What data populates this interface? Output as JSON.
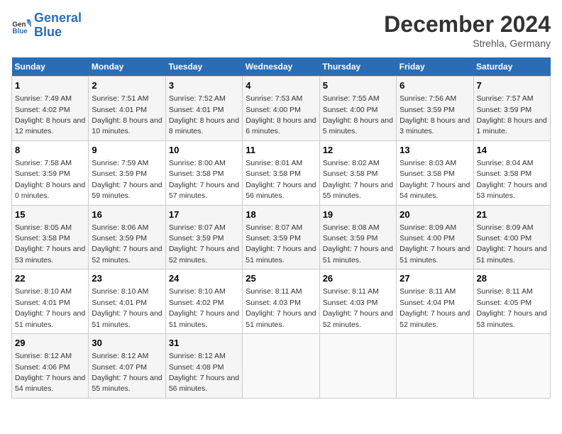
{
  "logo": {
    "line1": "General",
    "line2": "Blue"
  },
  "title": "December 2024",
  "location": "Strehla, Germany",
  "days_of_week": [
    "Sunday",
    "Monday",
    "Tuesday",
    "Wednesday",
    "Thursday",
    "Friday",
    "Saturday"
  ],
  "weeks": [
    [
      {
        "num": "1",
        "sunrise": "7:49 AM",
        "sunset": "4:02 PM",
        "daylight": "8 hours and 12 minutes."
      },
      {
        "num": "2",
        "sunrise": "7:51 AM",
        "sunset": "4:01 PM",
        "daylight": "8 hours and 10 minutes."
      },
      {
        "num": "3",
        "sunrise": "7:52 AM",
        "sunset": "4:01 PM",
        "daylight": "8 hours and 8 minutes."
      },
      {
        "num": "4",
        "sunrise": "7:53 AM",
        "sunset": "4:00 PM",
        "daylight": "8 hours and 6 minutes."
      },
      {
        "num": "5",
        "sunrise": "7:55 AM",
        "sunset": "4:00 PM",
        "daylight": "8 hours and 5 minutes."
      },
      {
        "num": "6",
        "sunrise": "7:56 AM",
        "sunset": "3:59 PM",
        "daylight": "8 hours and 3 minutes."
      },
      {
        "num": "7",
        "sunrise": "7:57 AM",
        "sunset": "3:59 PM",
        "daylight": "8 hours and 1 minute."
      }
    ],
    [
      {
        "num": "8",
        "sunrise": "7:58 AM",
        "sunset": "3:59 PM",
        "daylight": "8 hours and 0 minutes."
      },
      {
        "num": "9",
        "sunrise": "7:59 AM",
        "sunset": "3:59 PM",
        "daylight": "7 hours and 59 minutes."
      },
      {
        "num": "10",
        "sunrise": "8:00 AM",
        "sunset": "3:58 PM",
        "daylight": "7 hours and 57 minutes."
      },
      {
        "num": "11",
        "sunrise": "8:01 AM",
        "sunset": "3:58 PM",
        "daylight": "7 hours and 56 minutes."
      },
      {
        "num": "12",
        "sunrise": "8:02 AM",
        "sunset": "3:58 PM",
        "daylight": "7 hours and 55 minutes."
      },
      {
        "num": "13",
        "sunrise": "8:03 AM",
        "sunset": "3:58 PM",
        "daylight": "7 hours and 54 minutes."
      },
      {
        "num": "14",
        "sunrise": "8:04 AM",
        "sunset": "3:58 PM",
        "daylight": "7 hours and 53 minutes."
      }
    ],
    [
      {
        "num": "15",
        "sunrise": "8:05 AM",
        "sunset": "3:58 PM",
        "daylight": "7 hours and 53 minutes."
      },
      {
        "num": "16",
        "sunrise": "8:06 AM",
        "sunset": "3:59 PM",
        "daylight": "7 hours and 52 minutes."
      },
      {
        "num": "17",
        "sunrise": "8:07 AM",
        "sunset": "3:59 PM",
        "daylight": "7 hours and 52 minutes."
      },
      {
        "num": "18",
        "sunrise": "8:07 AM",
        "sunset": "3:59 PM",
        "daylight": "7 hours and 51 minutes."
      },
      {
        "num": "19",
        "sunrise": "8:08 AM",
        "sunset": "3:59 PM",
        "daylight": "7 hours and 51 minutes."
      },
      {
        "num": "20",
        "sunrise": "8:09 AM",
        "sunset": "4:00 PM",
        "daylight": "7 hours and 51 minutes."
      },
      {
        "num": "21",
        "sunrise": "8:09 AM",
        "sunset": "4:00 PM",
        "daylight": "7 hours and 51 minutes."
      }
    ],
    [
      {
        "num": "22",
        "sunrise": "8:10 AM",
        "sunset": "4:01 PM",
        "daylight": "7 hours and 51 minutes."
      },
      {
        "num": "23",
        "sunrise": "8:10 AM",
        "sunset": "4:01 PM",
        "daylight": "7 hours and 51 minutes."
      },
      {
        "num": "24",
        "sunrise": "8:10 AM",
        "sunset": "4:02 PM",
        "daylight": "7 hours and 51 minutes."
      },
      {
        "num": "25",
        "sunrise": "8:11 AM",
        "sunset": "4:03 PM",
        "daylight": "7 hours and 51 minutes."
      },
      {
        "num": "26",
        "sunrise": "8:11 AM",
        "sunset": "4:03 PM",
        "daylight": "7 hours and 52 minutes."
      },
      {
        "num": "27",
        "sunrise": "8:11 AM",
        "sunset": "4:04 PM",
        "daylight": "7 hours and 52 minutes."
      },
      {
        "num": "28",
        "sunrise": "8:11 AM",
        "sunset": "4:05 PM",
        "daylight": "7 hours and 53 minutes."
      }
    ],
    [
      {
        "num": "29",
        "sunrise": "8:12 AM",
        "sunset": "4:06 PM",
        "daylight": "7 hours and 54 minutes."
      },
      {
        "num": "30",
        "sunrise": "8:12 AM",
        "sunset": "4:07 PM",
        "daylight": "7 hours and 55 minutes."
      },
      {
        "num": "31",
        "sunrise": "8:12 AM",
        "sunset": "4:08 PM",
        "daylight": "7 hours and 56 minutes."
      },
      null,
      null,
      null,
      null
    ]
  ]
}
